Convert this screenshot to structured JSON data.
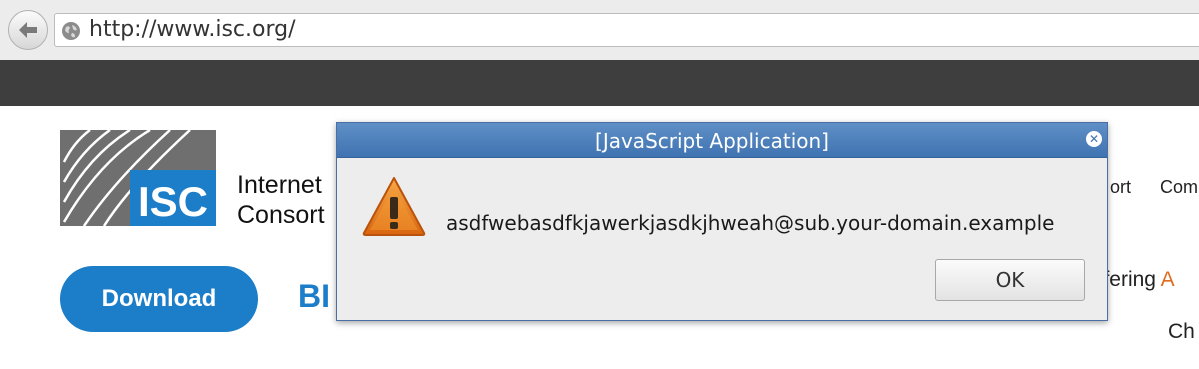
{
  "browser": {
    "url": "http://www.isc.org/"
  },
  "page": {
    "logo_text": "ISC",
    "org_name_line1": "Internet",
    "org_name_line2": "Consort",
    "nav_items": [
      "ort",
      "Com"
    ],
    "download_label": "Download",
    "heading_partial": "BI",
    "offering_partial": "ffering ",
    "offering_accent": "A",
    "ch_partial": "Ch"
  },
  "dialog": {
    "title": "[JavaScript Application]",
    "message": "asdfwebasdfkjawerkjasdkjhweah@sub.your-domain.example",
    "ok_label": "OK"
  },
  "colors": {
    "brand_blue": "#1c7dc9",
    "nav_bar": "#3e3e3e",
    "dialog_title_blue": "#3f73b1",
    "accent_orange": "#e36a1e"
  }
}
